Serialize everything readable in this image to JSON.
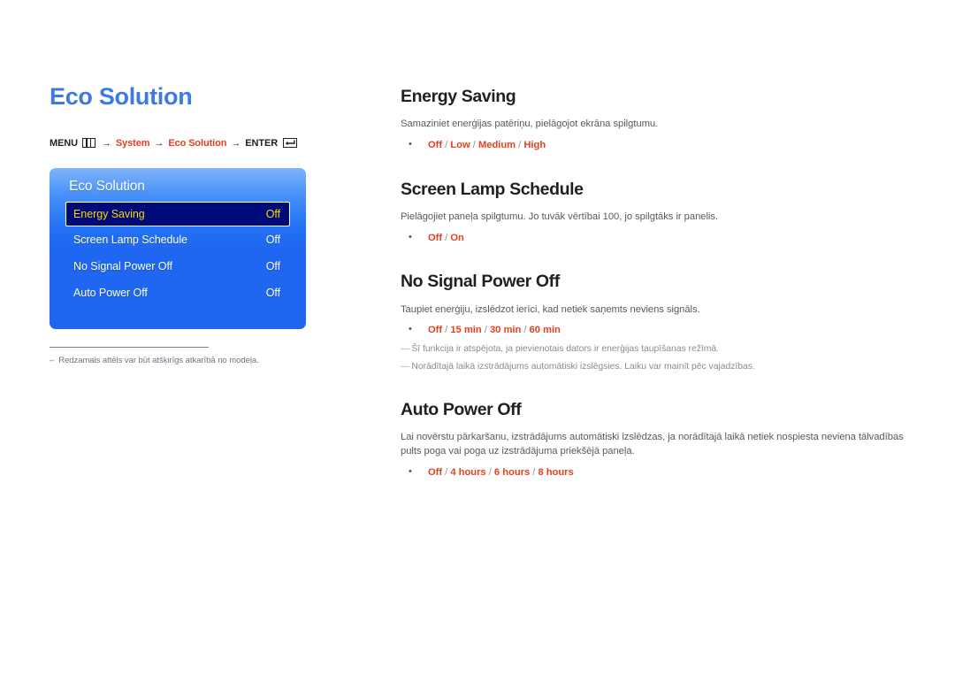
{
  "page": {
    "title": "Eco Solution"
  },
  "menu_path": {
    "menu_label": "MENU",
    "menu_icon": "menu-grid-icon",
    "arrow": "→",
    "step1": "System",
    "step2": "Eco Solution",
    "enter_label": "ENTER",
    "enter_icon": "enter-return-icon"
  },
  "osd": {
    "title": "Eco Solution",
    "rows": [
      {
        "label": "Energy Saving",
        "value": "Off",
        "selected": true
      },
      {
        "label": "Screen Lamp Schedule",
        "value": "Off",
        "selected": false
      },
      {
        "label": "No Signal Power Off",
        "value": "Off",
        "selected": false
      },
      {
        "label": "Auto Power Off",
        "value": "Off",
        "selected": false
      }
    ]
  },
  "footnote": {
    "dash": "–",
    "text": "Redzamais attēls var būt atšķirīgs atkarībā no modeļa."
  },
  "sections": [
    {
      "title": "Energy Saving",
      "desc": "Samaziniet enerģijas patēriņu, pielāgojot ekrāna spilgtumu.",
      "bullet": "•",
      "options": [
        "Off",
        "Low",
        "Medium",
        "High"
      ],
      "options_sep": " / ",
      "notes": []
    },
    {
      "title": "Screen Lamp Schedule",
      "desc": "Pielāgojiet paneļa spilgtumu. Jo tuvāk vērtībai 100, jo spilgtāks ir panelis.",
      "bullet": "•",
      "options": [
        "Off",
        "On"
      ],
      "options_sep": " / ",
      "notes": []
    },
    {
      "title": "No Signal Power Off",
      "desc": "Taupiet enerģiju, izslēdzot ierīci, kad netiek saņemts neviens signāls.",
      "bullet": "•",
      "options": [
        "Off",
        "15 min",
        "30 min",
        "60 min"
      ],
      "options_sep": " / ",
      "notes": [
        "Šī funkcija ir atspējota, ja pievienotais dators ir enerģijas taupīšanas režīmā.",
        "Norādītajā laikā izstrādājums automātiski izslēgsies. Laiku var mainīt pēc vajadzības."
      ],
      "note_marker": "—"
    },
    {
      "title": "Auto Power Off",
      "desc": "Lai novērstu pārkaršanu, izstrādājums automātiski izslēdzas, ja norādītajā laikā netiek nospiesta neviena tālvadības pults poga vai poga uz izstrādājuma priekšējā paneļa.",
      "bullet": "•",
      "options": [
        "Off",
        "4 hours",
        "6 hours",
        "8 hours"
      ],
      "options_sep": " / ",
      "notes": []
    }
  ],
  "colors": {
    "title_blue": "#3d7ae4",
    "accent_red": "#e8401f",
    "osd_blue": "#1f66f0",
    "osd_selected_bg": "#000b7a",
    "osd_selected_text": "#ffd400",
    "body_gray": "#58595b",
    "note_gray": "#8a8c8e"
  }
}
